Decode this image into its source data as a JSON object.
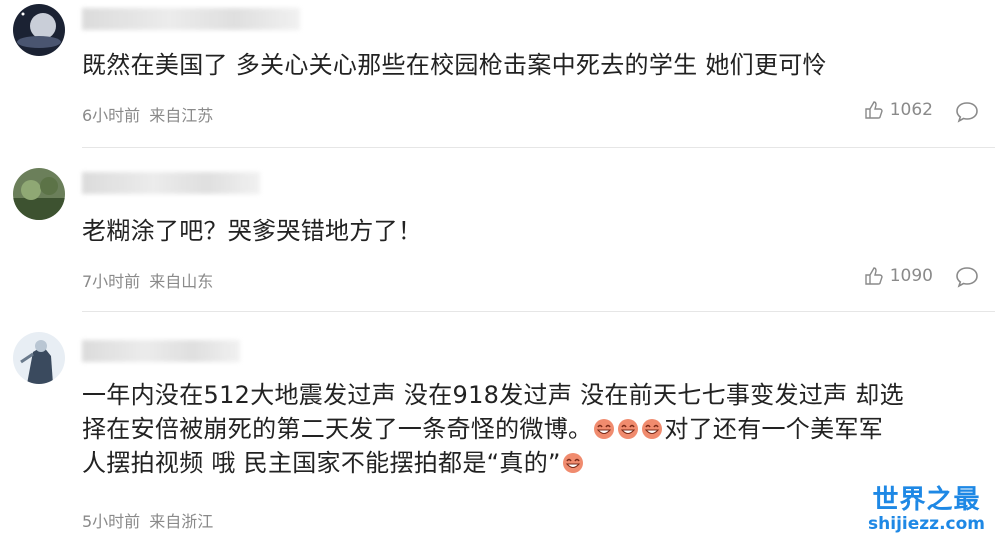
{
  "comments": [
    {
      "text": "既然在美国了 多关心关心那些在校园枪击案中死去的学生 她们更可怜",
      "time": "6小时前",
      "location": "来自江苏",
      "likes": "1062",
      "avatar_icon": "avatar-planet",
      "name": ""
    },
    {
      "text": "老糊涂了吧？哭爹哭错地方了！",
      "time": "7小时前",
      "location": "来自山东",
      "likes": "1090",
      "avatar_icon": "avatar-landscape",
      "name": ""
    },
    {
      "text_line1": "一年内没在512大地震发过声 没在918发过声 没在前天七七事变发过声 却选",
      "text_line2": "择在安倍被崩死的第二天发了一条奇怪的微博。",
      "text_line2b": "对了还有一个美军军",
      "text_line3": "人摆拍视频 哦 民主国家不能摆拍都是“真的”",
      "time": "5小时前",
      "location": "来自浙江",
      "avatar_icon": "avatar-character",
      "name": ""
    }
  ],
  "watermark": {
    "title": "世界之最",
    "url": "shijiezz.com"
  },
  "icons": {
    "like": "thumbs-up-icon",
    "reply": "comment-bubble-icon",
    "emoji": "laughing-face-emoji"
  },
  "colors": {
    "text": "#222222",
    "meta": "#8a8a8a",
    "watermark": "#1e88e5"
  }
}
